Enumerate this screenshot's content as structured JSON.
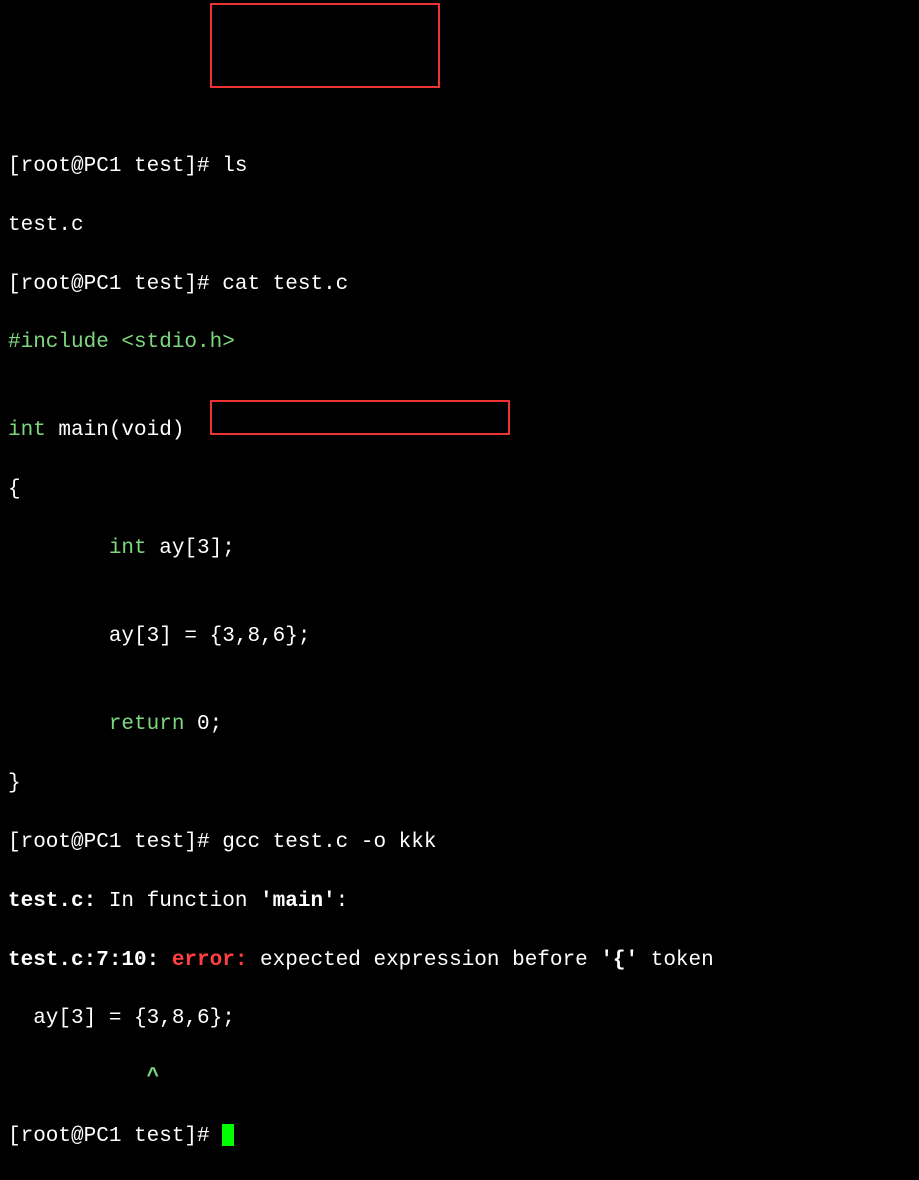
{
  "prompt1": "[root@PC1 test]# ",
  "cmd1": "ls",
  "out1": "test.c",
  "prompt2": "[root@PC1 test]# ",
  "cmd2": "cat test.c",
  "src_line1a": "#include ",
  "src_line1b": "<stdio.h>",
  "src_blank": "",
  "src_line3a": "int",
  "src_line3b": " main(void)",
  "src_line4": "{",
  "src_line5a": "        int",
  "src_line5b": " ay[3];",
  "src_line7": "        ay[3] = {3,8,6};",
  "src_line9a": "        return",
  "src_line9b": " 0;",
  "src_line10": "}",
  "prompt3": "[root@PC1 test]# ",
  "cmd3": "gcc test.c -o kkk",
  "err_file1": "test.c:",
  "err_in": " In function ",
  "err_main": "'main'",
  "err_colon": ":",
  "err_loc": "test.c:7:10: ",
  "err_label": "error:",
  "err_msg1": " expected expression before ",
  "err_tok": "'{'",
  "err_msg2": " token",
  "err_code": "  ay[3] = {3,8,6};",
  "err_caret": "           ^",
  "prompt4": "[root@PC1 test]# "
}
